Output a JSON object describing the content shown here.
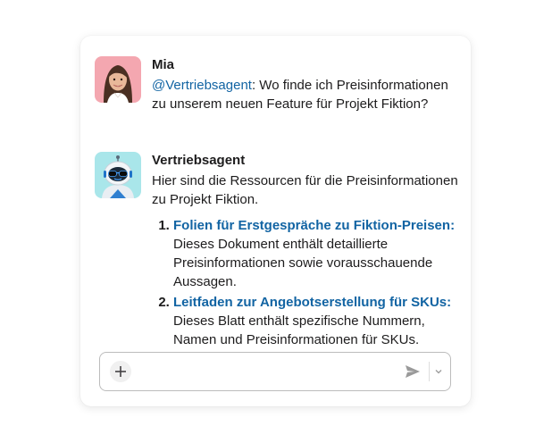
{
  "messages": [
    {
      "author": "Mia",
      "mention": "@Vertriebsagent",
      "text": ": Wo finde ich Preisinformationen zu unserem neuen Feature für Projekt Fiktion?",
      "avatar_icon": "user-photo-avatar"
    },
    {
      "author": "Vertriebsagent",
      "text": "Hier sind die Ressourcen für die Preisinformationen zu Projekt Fiktion.",
      "avatar_icon": "robot-avatar",
      "items": [
        {
          "title": "Folien für Erstgespräche zu Fiktion-Preisen:",
          "description": "Dieses Dokument enthält detaillierte Preisinformationen sowie vorausschauende Aussagen."
        },
        {
          "title": "Leitfaden zur Angebotserstellung für SKUs:",
          "description": "Dieses Blatt enthält spezifische Nummern, Namen und Preisinformationen für SKUs."
        }
      ]
    }
  ],
  "composer": {
    "placeholder": "",
    "add_icon": "plus-icon",
    "send_icon": "send-icon",
    "options_icon": "chevron-down-icon"
  },
  "colors": {
    "link": "#1264a3",
    "text": "#1d1c1d",
    "border": "#bcbcbc"
  }
}
